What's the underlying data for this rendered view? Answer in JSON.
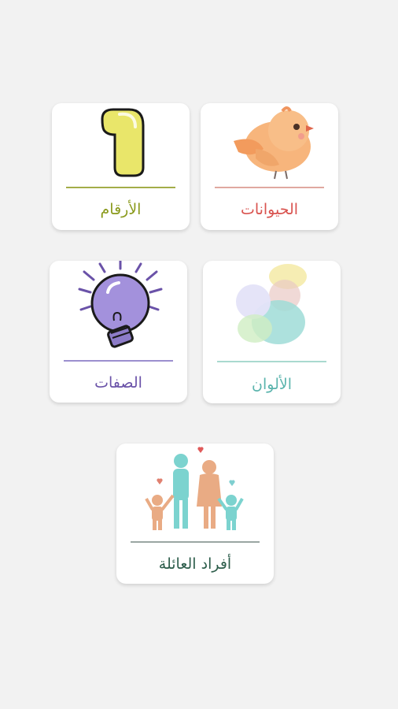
{
  "categories": {
    "numbers": {
      "label": "الأرقام",
      "icon": "number-one-icon",
      "color": "#8a9a1c",
      "line_color": "#a3ad48"
    },
    "animals": {
      "label": "الحيوانات",
      "icon": "bird-icon",
      "color": "#d9534f",
      "line_color": "#e0a8a0"
    },
    "traits": {
      "label": "الصفات",
      "icon": "lightbulb-icon",
      "color": "#6a52a8",
      "line_color": "#9b8fcf"
    },
    "colors": {
      "label": "الألوان",
      "icon": "color-circles-icon",
      "color": "#5bb4ad",
      "line_color": "#a9d9cf"
    },
    "family": {
      "label": "أفراد العائلة",
      "icon": "family-icon",
      "color": "#2e5e4c",
      "line_color": "#9aa6a2"
    }
  }
}
